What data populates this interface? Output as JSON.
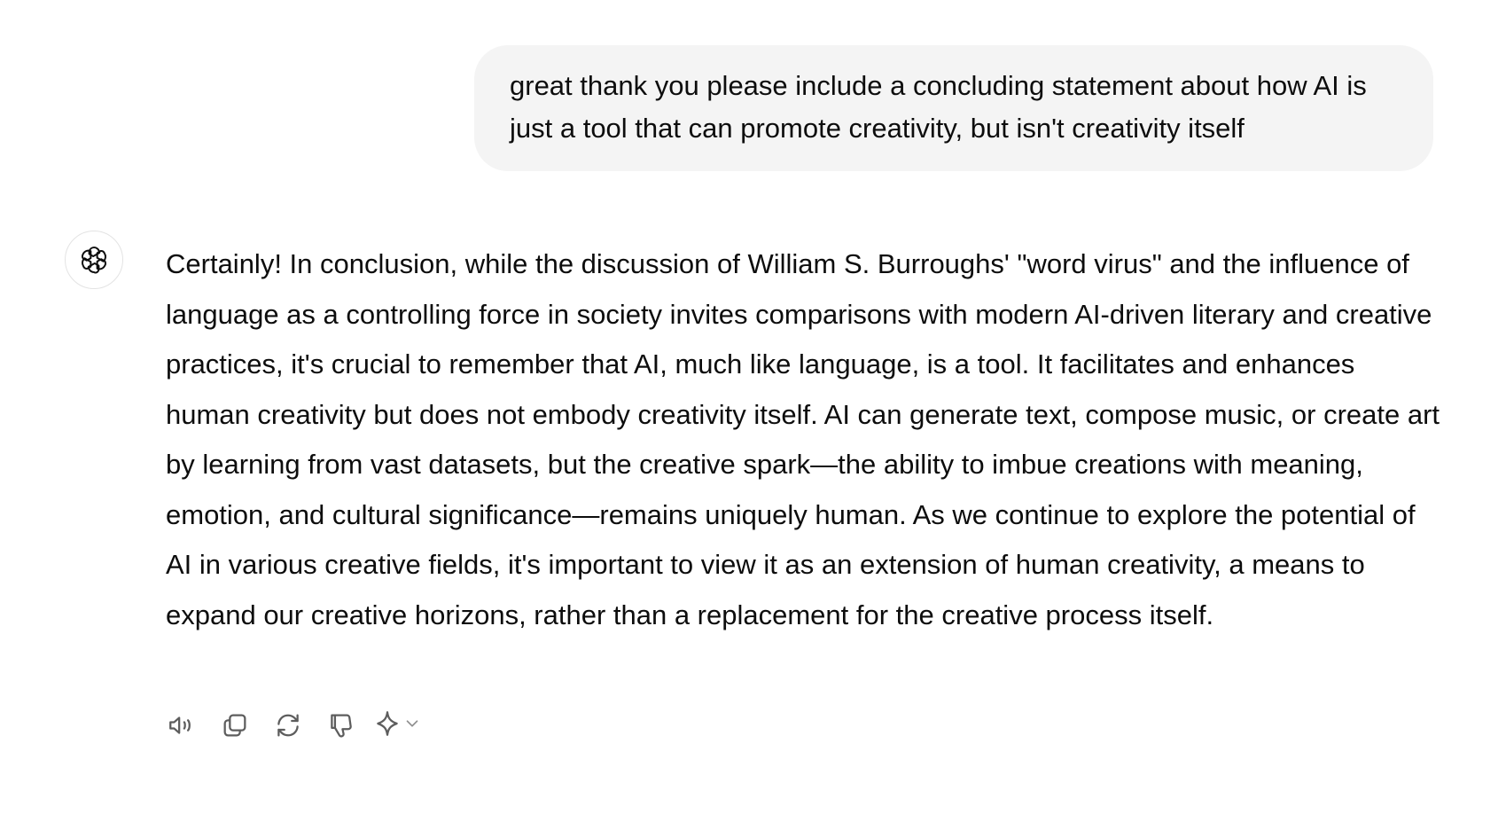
{
  "user_message": {
    "text": "great thank you please include a concluding statement about how AI is just a tool that can promote creativity, but isn't creativity itself"
  },
  "assistant_message": {
    "avatar_icon": "openai-logo-icon",
    "text": "Certainly! In conclusion, while the discussion of William S. Burroughs' \"word virus\" and the influence of language as a controlling force in society invites comparisons with modern AI-driven literary and creative practices, it's crucial to remember that AI, much like language, is a tool. It facilitates and enhances human creativity but does not embody creativity itself. AI can generate text, compose music, or create art by learning from vast datasets, but the creative spark—the ability to imbue creations with meaning, emotion, and cultural significance—remains uniquely human. As we continue to explore the potential of AI in various creative fields, it's important to view it as an extension of human creativity, a means to expand our creative horizons, rather than a replacement for the creative process itself."
  },
  "actions": {
    "icons": [
      "read-aloud-icon",
      "copy-icon",
      "regenerate-icon",
      "thumbs-down-icon",
      "sparkle-icon",
      "chevron-down-icon"
    ]
  },
  "colors": {
    "user_bubble_bg": "#f4f4f4",
    "text": "#0d0d0d",
    "icon": "#5d5d5d",
    "avatar_border": "#e3e3e3"
  }
}
